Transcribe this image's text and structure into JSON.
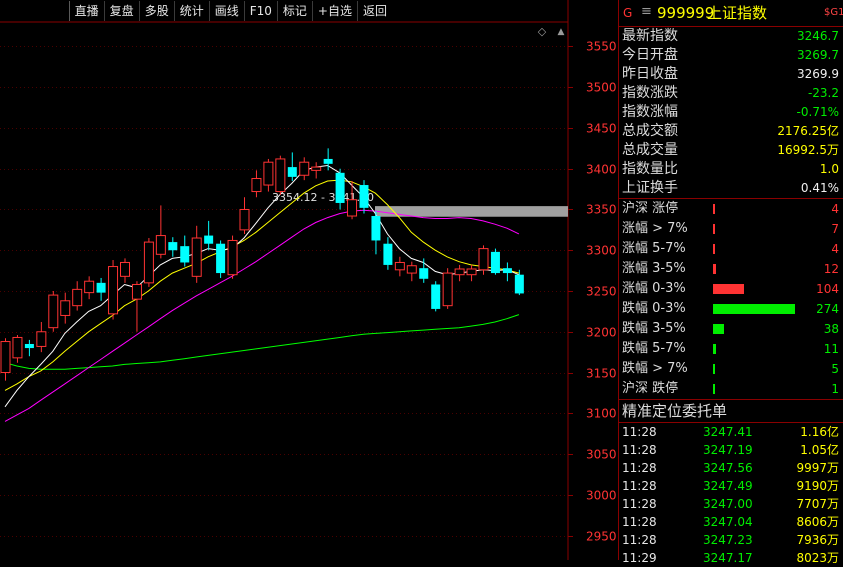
{
  "toolbar": {
    "items": [
      "直播",
      "复盘",
      "多股",
      "统计",
      "画线",
      "F10",
      "标记",
      "+自选",
      "返回"
    ]
  },
  "chart_data": {
    "type": "candlestick",
    "title": "",
    "ylim": [
      2920,
      3580
    ],
    "y_ticks": [
      3550,
      3500,
      3450,
      3400,
      3350,
      3300,
      3250,
      3200,
      3150,
      3100,
      3050,
      3000,
      2950
    ],
    "price_band_label": "3354.12 - 3341.10",
    "price_band": [
      3341.1,
      3354.12
    ],
    "colors": {
      "up": "#ff3333",
      "down": "#00ffff",
      "ma_short": "#ffffff",
      "ma_mid": "#ffff00",
      "ma_long": "#ff00ff",
      "ma_longest": "#00ff00",
      "band": "#a0a0a0",
      "axis_label": "#ff3333",
      "grid": "#4a0000"
    },
    "candles": [
      {
        "o": 3150,
        "c": 3188,
        "h": 3192,
        "l": 3140
      },
      {
        "o": 3168,
        "c": 3193,
        "h": 3196,
        "l": 3162
      },
      {
        "o": 3185,
        "c": 3180,
        "h": 3190,
        "l": 3170
      },
      {
        "o": 3182,
        "c": 3200,
        "h": 3212,
        "l": 3175
      },
      {
        "o": 3205,
        "c": 3245,
        "h": 3250,
        "l": 3200
      },
      {
        "o": 3220,
        "c": 3238,
        "h": 3248,
        "l": 3210
      },
      {
        "o": 3232,
        "c": 3252,
        "h": 3262,
        "l": 3226
      },
      {
        "o": 3248,
        "c": 3262,
        "h": 3268,
        "l": 3240
      },
      {
        "o": 3260,
        "c": 3248,
        "h": 3266,
        "l": 3238
      },
      {
        "o": 3222,
        "c": 3280,
        "h": 3288,
        "l": 3215
      },
      {
        "o": 3268,
        "c": 3285,
        "h": 3290,
        "l": 3260
      },
      {
        "o": 3240,
        "c": 3258,
        "h": 3262,
        "l": 3200
      },
      {
        "o": 3260,
        "c": 3310,
        "h": 3315,
        "l": 3255
      },
      {
        "o": 3295,
        "c": 3318,
        "h": 3355,
        "l": 3290
      },
      {
        "o": 3310,
        "c": 3300,
        "h": 3316,
        "l": 3292
      },
      {
        "o": 3305,
        "c": 3285,
        "h": 3318,
        "l": 3280
      },
      {
        "o": 3268,
        "c": 3315,
        "h": 3330,
        "l": 3260
      },
      {
        "o": 3318,
        "c": 3308,
        "h": 3336,
        "l": 3300
      },
      {
        "o": 3308,
        "c": 3272,
        "h": 3312,
        "l": 3266
      },
      {
        "o": 3270,
        "c": 3312,
        "h": 3318,
        "l": 3265
      },
      {
        "o": 3325,
        "c": 3350,
        "h": 3365,
        "l": 3320
      },
      {
        "o": 3372,
        "c": 3388,
        "h": 3398,
        "l": 3365
      },
      {
        "o": 3380,
        "c": 3408,
        "h": 3412,
        "l": 3372
      },
      {
        "o": 3372,
        "c": 3412,
        "h": 3416,
        "l": 3368
      },
      {
        "o": 3402,
        "c": 3390,
        "h": 3420,
        "l": 3385
      },
      {
        "o": 3392,
        "c": 3408,
        "h": 3414,
        "l": 3386
      },
      {
        "o": 3398,
        "c": 3402,
        "h": 3408,
        "l": 3388
      },
      {
        "o": 3412,
        "c": 3406,
        "h": 3425,
        "l": 3398
      },
      {
        "o": 3395,
        "c": 3358,
        "h": 3400,
        "l": 3350
      },
      {
        "o": 3342,
        "c": 3362,
        "h": 3385,
        "l": 3338
      },
      {
        "o": 3380,
        "c": 3352,
        "h": 3386,
        "l": 3345
      },
      {
        "o": 3342,
        "c": 3312,
        "h": 3348,
        "l": 3295
      },
      {
        "o": 3308,
        "c": 3282,
        "h": 3316,
        "l": 3276
      },
      {
        "o": 3276,
        "c": 3285,
        "h": 3292,
        "l": 3268
      },
      {
        "o": 3272,
        "c": 3281,
        "h": 3286,
        "l": 3262
      },
      {
        "o": 3278,
        "c": 3265,
        "h": 3290,
        "l": 3260
      },
      {
        "o": 3258,
        "c": 3228,
        "h": 3262,
        "l": 3225
      },
      {
        "o": 3232,
        "c": 3272,
        "h": 3278,
        "l": 3228
      },
      {
        "o": 3270,
        "c": 3277,
        "h": 3282,
        "l": 3262
      },
      {
        "o": 3270,
        "c": 3277,
        "h": 3282,
        "l": 3262
      },
      {
        "o": 3276,
        "c": 3302,
        "h": 3306,
        "l": 3270
      },
      {
        "o": 3298,
        "c": 3272,
        "h": 3302,
        "l": 3270
      },
      {
        "o": 3278,
        "c": 3272,
        "h": 3285,
        "l": 3262
      },
      {
        "o": 3270,
        "c": 3247,
        "h": 3276,
        "l": 3245
      }
    ],
    "ma_short": [
      3108,
      3128,
      3145,
      3160,
      3176,
      3198,
      3212,
      3225,
      3232,
      3245,
      3258,
      3254,
      3268,
      3282,
      3290,
      3292,
      3296,
      3302,
      3300,
      3302,
      3315,
      3333,
      3352,
      3368,
      3382,
      3398,
      3402,
      3404,
      3395,
      3380,
      3365,
      3345,
      3320,
      3302,
      3290,
      3285,
      3274,
      3270,
      3272,
      3274,
      3276,
      3275,
      3276,
      3270
    ],
    "ma_mid": [
      3128,
      3136,
      3145,
      3152,
      3163,
      3176,
      3188,
      3200,
      3210,
      3220,
      3232,
      3240,
      3250,
      3262,
      3272,
      3278,
      3284,
      3292,
      3298,
      3304,
      3312,
      3322,
      3334,
      3346,
      3358,
      3370,
      3379,
      3385,
      3386,
      3384,
      3378,
      3370,
      3356,
      3340,
      3322,
      3310,
      3300,
      3292,
      3286,
      3282,
      3280,
      3278,
      3276,
      3272
    ],
    "ma_long": [
      3090,
      3098,
      3106,
      3116,
      3126,
      3136,
      3146,
      3156,
      3166,
      3176,
      3186,
      3196,
      3206,
      3216,
      3226,
      3235,
      3244,
      3252,
      3260,
      3268,
      3277,
      3286,
      3296,
      3306,
      3316,
      3326,
      3334,
      3340,
      3345,
      3348,
      3349,
      3348,
      3346,
      3344,
      3342,
      3340,
      3339,
      3339,
      3340,
      3339,
      3336,
      3332,
      3327,
      3320
    ],
    "ma_longest": [
      3162,
      3158,
      3155,
      3154,
      3154,
      3154,
      3155,
      3156,
      3157,
      3158,
      3160,
      3161,
      3162,
      3163,
      3165,
      3167,
      3169,
      3171,
      3173,
      3175,
      3177,
      3179,
      3181,
      3183,
      3185,
      3187,
      3189,
      3191,
      3193,
      3195,
      3197,
      3198,
      3199,
      3200,
      3201,
      3202,
      3203,
      3204,
      3205,
      3207,
      3209,
      3212,
      3216,
      3221
    ]
  },
  "quote": {
    "flag": "G",
    "menu_icon": "menu-icon",
    "code": "999999",
    "name": "上证指数",
    "tag": "$G1",
    "rows": [
      {
        "label": "最新指数",
        "value": "3246.7",
        "color": "#00ee00"
      },
      {
        "label": "今日开盘",
        "value": "3269.7",
        "color": "#00ee00"
      },
      {
        "label": "昨日收盘",
        "value": "3269.9",
        "color": "#f0f0f0"
      },
      {
        "label": "指数涨跌",
        "value": "-23.2",
        "color": "#00ee00"
      },
      {
        "label": "指数涨幅",
        "value": "-0.71%",
        "color": "#00ee00"
      },
      {
        "label": "总成交额",
        "value": "2176.25亿",
        "color": "#ffff00"
      },
      {
        "label": "总成交量",
        "value": "16992.5万",
        "color": "#ffff00"
      },
      {
        "label": "指数量比",
        "value": "1.0",
        "color": "#ffff00"
      },
      {
        "label": "上证换手",
        "value": "0.41%",
        "color": "#f0f0f0"
      }
    ]
  },
  "distribution": [
    {
      "label": "沪深 涨停",
      "count": "4",
      "bar_fraction": 0.0,
      "color": "#ff3333"
    },
    {
      "label": "涨幅 > 7%",
      "count": "7",
      "bar_fraction": 0.01,
      "color": "#ff3333"
    },
    {
      "label": "涨幅 5-7%",
      "count": "4",
      "bar_fraction": 0.0,
      "color": "#ff3333"
    },
    {
      "label": "涨幅 3-5%",
      "count": "12",
      "bar_fraction": 0.04,
      "color": "#ff3333"
    },
    {
      "label": "涨幅 0-3%",
      "count": "104",
      "bar_fraction": 0.38,
      "color": "#ff3333"
    },
    {
      "label": "跌幅 0-3%",
      "count": "274",
      "bar_fraction": 1.0,
      "color": "#00ee00"
    },
    {
      "label": "跌幅 3-5%",
      "count": "38",
      "bar_fraction": 0.14,
      "color": "#00ee00"
    },
    {
      "label": "跌幅 5-7%",
      "count": "11",
      "bar_fraction": 0.04,
      "color": "#00ee00"
    },
    {
      "label": "跌幅 > 7%",
      "count": "5",
      "bar_fraction": 0.01,
      "color": "#00ee00"
    },
    {
      "label": "沪深 跌停",
      "count": "1",
      "bar_fraction": 0.0,
      "color": "#00ee00"
    }
  ],
  "orders": {
    "title": "精准定位委托单",
    "rows": [
      {
        "time": "11:28",
        "price": "3247.41",
        "amount": "1.16亿"
      },
      {
        "time": "11:28",
        "price": "3247.19",
        "amount": "1.05亿"
      },
      {
        "time": "11:28",
        "price": "3247.56",
        "amount": "9997万"
      },
      {
        "time": "11:28",
        "price": "3247.49",
        "amount": "9190万"
      },
      {
        "time": "11:28",
        "price": "3247.00",
        "amount": "7707万"
      },
      {
        "time": "11:28",
        "price": "3247.04",
        "amount": "8606万"
      },
      {
        "time": "11:28",
        "price": "3247.23",
        "amount": "7936万"
      },
      {
        "time": "11:29",
        "price": "3247.17",
        "amount": "8023万"
      }
    ]
  }
}
